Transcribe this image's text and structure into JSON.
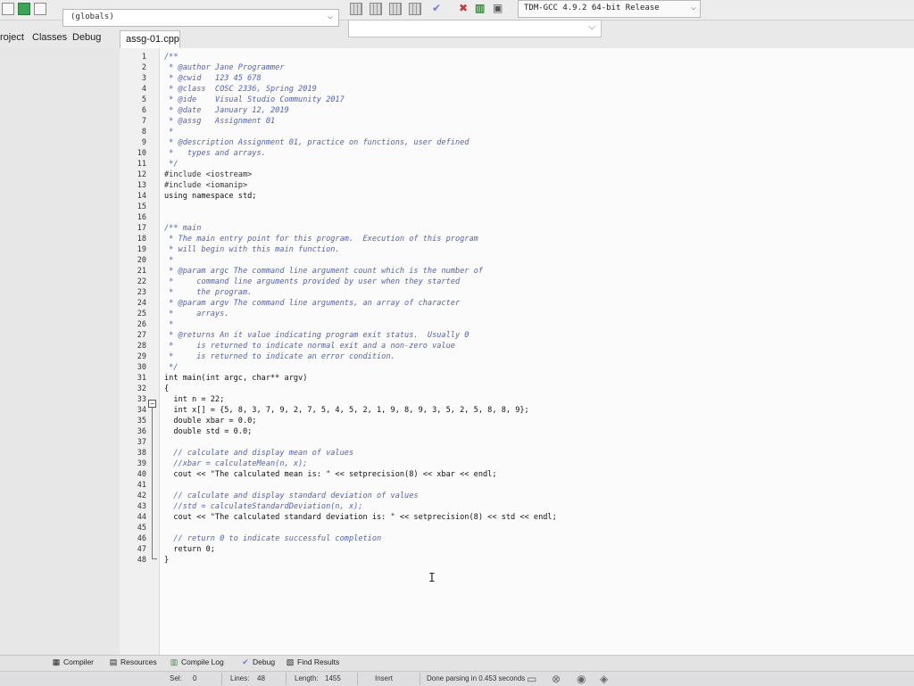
{
  "toolbar": {
    "globals_combo": "(globals)",
    "compiler_combo": "TDM-GCC 4.9.2 64-bit Release"
  },
  "left_tabs": [
    "roject",
    "Classes",
    "Debug"
  ],
  "file_tab": "assg-01.cpp",
  "editor": {
    "line_numbers": [
      "1",
      "2",
      "3",
      "4",
      "5",
      "6",
      "7",
      "8",
      "9",
      "10",
      "11",
      "12",
      "13",
      "14",
      "15",
      "16",
      "17",
      "18",
      "19",
      "20",
      "21",
      "22",
      "23",
      "24",
      "25",
      "26",
      "27",
      "28",
      "29",
      "30",
      "31",
      "32",
      "33",
      "34",
      "35",
      "36",
      "37",
      "38",
      "39",
      "40",
      "41",
      "42",
      "43",
      "44",
      "45",
      "46",
      "47",
      "48"
    ],
    "lines": [
      "/**",
      " * @author Jane Programmer",
      " * @cwid   123 45 678",
      " * @class  COSC 2336, Spring 2019",
      " * @ide    Visual Studio Community 2017",
      " * @date   January 12, 2019",
      " * @assg   Assignment 01",
      " *",
      " * @description Assignment 01, practice on functions, user defined",
      " *   types and arrays.",
      " */",
      "#include <iostream>",
      "#include <iomanip>",
      "using namespace std;",
      "",
      "",
      "/** main",
      " * The main entry point for this program.  Execution of this program",
      " * will begin with this main function.",
      " *",
      " * @param argc The command line argument count which is the number of",
      " *     command line arguments provided by user when they started",
      " *     the program.",
      " * @param argv The command line arguments, an array of character",
      " *     arrays.",
      " *",
      " * @returns An it value indicating program exit status.  Usually 0",
      " *     is returned to indicate normal exit and a non-zero value",
      " *     is returned to indicate an error condition.",
      " */",
      "int main(int argc, char** argv)",
      "{",
      "  int n = 22;",
      "  int x[] = {5, 8, 3, 7, 9, 2, 7, 5, 4, 5, 2, 1, 9, 8, 9, 3, 5, 2, 5, 8, 8, 9};",
      "  double xbar = 0.0;",
      "  double std = 0.0;",
      "",
      "  // calculate and display mean of values",
      "  //xbar = calculateMean(n, x);",
      "  cout << \"The calculated mean is: \" << setprecision(8) << xbar << endl;",
      "",
      "  // calculate and display standard deviation of values",
      "  //std = calculateStandardDeviation(n, x);",
      "  cout << \"The calculated standard deviation is: \" << setprecision(8) << std << endl;",
      "",
      "  // return 0 to indicate successful completion",
      "  return 0;",
      "}"
    ],
    "fold_symbol": "−"
  },
  "bottom_tabs": [
    "Compiler",
    "Resources",
    "Compile Log",
    "Debug",
    "Find Results"
  ],
  "status": {
    "sel": "Sel:",
    "sel_value": "0",
    "lines": "Lines:",
    "lines_value": "48",
    "length": "Length:",
    "length_value": "1455",
    "mode": "Insert",
    "message": "Done parsing in 0.453 seconds"
  }
}
